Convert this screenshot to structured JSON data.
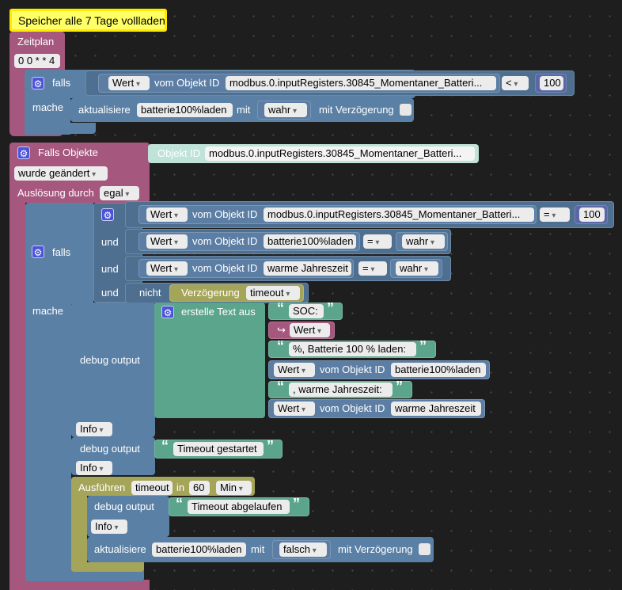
{
  "comment": {
    "text": "Speicher alle 7 Tage vollladen"
  },
  "schedule": {
    "label": "Zeitplan",
    "cron": "0 0 * * 4",
    "if_label": "falls",
    "do_label": "mache",
    "cond": {
      "value_dd": "Wert",
      "from_label": "vom Objekt ID",
      "object_id": "modbus.0.inputRegisters.30845_Momentaner_Batteri...",
      "op": "<",
      "number": "100"
    },
    "update": {
      "label": "aktualisiere",
      "var": "batterie100%laden",
      "with_label": "mit",
      "value": "wahr",
      "delay_label": "mit Verzögerung"
    }
  },
  "trigger": {
    "label": "Falls Objekte",
    "object_label": "Objekt ID",
    "object_id": "modbus.0.inputRegisters.30845_Momentaner_Batteri...",
    "changed": "wurde geändert",
    "cause_label": "Auslösung durch",
    "cause_value": "egal",
    "if_label": "falls",
    "do_label": "mache",
    "and_label": "und",
    "not_label": "nicht",
    "cond1": {
      "value_dd": "Wert",
      "from_label": "vom Objekt ID",
      "object_id": "modbus.0.inputRegisters.30845_Momentaner_Batteri...",
      "op": "=",
      "number": "100"
    },
    "cond2": {
      "value_dd": "Wert",
      "from_label": "vom Objekt ID",
      "object_id": "batterie100%laden",
      "op": "=",
      "value": "wahr"
    },
    "cond3": {
      "value_dd": "Wert",
      "from_label": "vom Objekt ID",
      "object_id": "warme Jahreszeit",
      "op": "=",
      "value": "wahr"
    },
    "cond4": {
      "label": "Verzögerung",
      "name": "timeout"
    },
    "debug1": {
      "label": "debug output",
      "level": "Info",
      "text_join_label": "erstelle Text aus",
      "parts": {
        "p1": "SOC:",
        "p2_var": "Wert",
        "p3": "%, Batterie 100 % laden:",
        "p4_value_dd": "Wert",
        "p4_from": "vom Objekt ID",
        "p4_id": "batterie100%laden",
        "p5": ", warme Jahreszeit:",
        "p6_value_dd": "Wert",
        "p6_from": "vom Objekt ID",
        "p6_id": "warme Jahreszeit"
      }
    },
    "debug2": {
      "label": "debug output",
      "text": "Timeout gestartet",
      "level": "Info"
    },
    "timeout_block": {
      "label": "Ausführen",
      "name": "timeout",
      "in_label": "in",
      "value": "60",
      "unit": "Min",
      "debug": {
        "label": "debug output",
        "text": "Timeout abgelaufen",
        "level": "Info"
      },
      "update": {
        "label": "aktualisiere",
        "var": "batterie100%laden",
        "with_label": "mit",
        "value": "falsch",
        "delay_label": "mit Verzögerung"
      }
    }
  },
  "icons": {
    "quote": "“",
    "quote_end": "”",
    "gear": "⚙",
    "var_arrow": "↪"
  }
}
